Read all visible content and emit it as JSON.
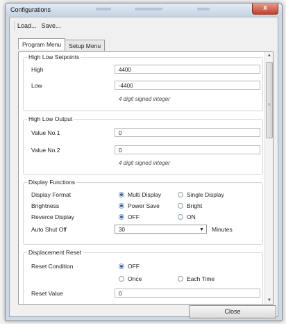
{
  "window": {
    "title": "Configurations",
    "close_glyph": "x"
  },
  "menu": {
    "items": [
      "Load...",
      "Save..."
    ]
  },
  "tabs": [
    {
      "label": "Program Menu",
      "active": true
    },
    {
      "label": "Setup Menu",
      "active": false
    }
  ],
  "high_low_setpoints": {
    "title": "High Low Setpoints",
    "high_label": "High",
    "high_value": "4400",
    "low_label": "Low",
    "low_value": "-4400",
    "hint": "4 digit signed integer"
  },
  "high_low_output": {
    "title": "High Low Output",
    "value1_label": "Value No.1",
    "value1": "0",
    "value2_label": "Value No.2",
    "value2": "0",
    "hint": "4 digit signed integer"
  },
  "display_functions": {
    "title": "Display Functions",
    "rows": [
      {
        "label": "Display Format",
        "options": [
          "Multi Display",
          "Single Display"
        ],
        "selected": 0
      },
      {
        "label": "Brightness",
        "options": [
          "Power Save",
          "Bright"
        ],
        "selected": 0
      },
      {
        "label": "Reverce Display",
        "options": [
          "OFF",
          "ON"
        ],
        "selected": 0
      }
    ],
    "auto_shut_off": {
      "label": "Auto Shut Off",
      "value": "30",
      "unit": "Minutes"
    }
  },
  "displacement_reset": {
    "title": "Displacement Reset",
    "reset_condition_label": "Reset Condition",
    "options": [
      "OFF",
      "Once",
      "Each Time"
    ],
    "selected": 0,
    "reset_value_label": "Reset Value",
    "reset_value": "0"
  },
  "footer": {
    "close_label": "Close"
  },
  "colors": {
    "accent": "#2c5fa8",
    "close_button": "#c2412c"
  },
  "icons": {
    "scroll_up": "up-arrow-icon",
    "scroll_down": "down-arrow-icon",
    "combo": "chevron-down-icon"
  }
}
